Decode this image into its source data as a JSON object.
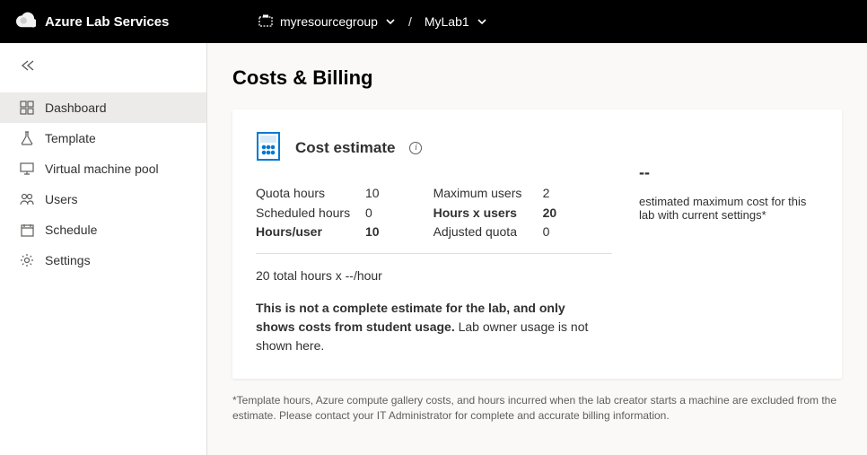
{
  "header": {
    "brand": "Azure Lab Services",
    "breadcrumb": {
      "resource_group": "myresourcegroup",
      "lab": "MyLab1"
    }
  },
  "sidebar": {
    "items": [
      {
        "label": "Dashboard",
        "icon": "dashboard"
      },
      {
        "label": "Template",
        "icon": "flask"
      },
      {
        "label": "Virtual machine pool",
        "icon": "monitor"
      },
      {
        "label": "Users",
        "icon": "users"
      },
      {
        "label": "Schedule",
        "icon": "calendar"
      },
      {
        "label": "Settings",
        "icon": "gear"
      }
    ]
  },
  "page": {
    "title": "Costs & Billing"
  },
  "cost_card": {
    "title": "Cost estimate",
    "metrics_left": {
      "quota_hours_label": "Quota hours",
      "quota_hours_value": "10",
      "scheduled_hours_label": "Scheduled hours",
      "scheduled_hours_value": "0",
      "hours_per_user_label": "Hours/user",
      "hours_per_user_value": "10"
    },
    "metrics_right": {
      "max_users_label": "Maximum users",
      "max_users_value": "2",
      "hours_x_users_label": "Hours x users",
      "hours_x_users_value": "20",
      "adjusted_quota_label": "Adjusted quota",
      "adjusted_quota_value": "0"
    },
    "formula": "20 total hours x --/hour",
    "disclaimer_bold": "This is not a complete estimate for the lab, and only shows costs from student usage.",
    "disclaimer_rest": " Lab owner usage is not shown here.",
    "est_value": "--",
    "est_caption": "estimated maximum cost for this lab with current settings*"
  },
  "footnote": "*Template hours, Azure compute gallery costs, and hours incurred when the lab creator starts a machine are excluded from the estimate. Please contact your IT Administrator for complete and accurate billing information."
}
